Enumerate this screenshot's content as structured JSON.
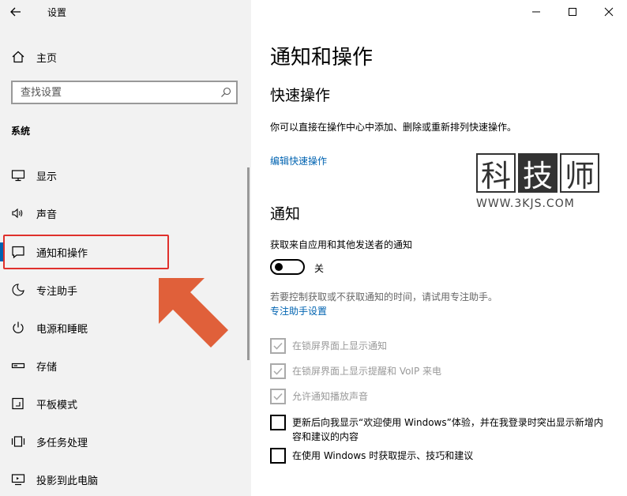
{
  "window": {
    "title": "设置"
  },
  "sidebar": {
    "home_label": "主页",
    "search_placeholder": "查找设置",
    "section": "系统",
    "items": [
      {
        "label": "显示"
      },
      {
        "label": "声音"
      },
      {
        "label": "通知和操作"
      },
      {
        "label": "专注助手"
      },
      {
        "label": "电源和睡眠"
      },
      {
        "label": "存储"
      },
      {
        "label": "平板模式"
      },
      {
        "label": "多任务处理"
      },
      {
        "label": "投影到此电脑"
      }
    ],
    "active_index": 2,
    "highlight_color": "#e0302c",
    "arrow_color": "#e0603a"
  },
  "main": {
    "title": "通知和操作",
    "quick_actions": {
      "heading": "快速操作",
      "description": "你可以直接在操作中心中添加、删除或重新排列快速操作。",
      "link": "编辑快速操作"
    },
    "notifications": {
      "heading": "通知",
      "toggle_label": "获取来自应用和其他发送者的通知",
      "toggle_state": "关",
      "hint": "若要控制获取或不获取通知的时间，请试用专注助手。",
      "hint_link": "专注助手设置",
      "checkboxes": [
        {
          "label": "在锁屏界面上显示通知",
          "checked": true,
          "disabled": true
        },
        {
          "label": "在锁屏界面上显示提醒和 VoIP 来电",
          "checked": true,
          "disabled": true
        },
        {
          "label": "允许通知播放声音",
          "checked": true,
          "disabled": true
        },
        {
          "label": "更新后向我显示“欢迎使用 Windows”体验，并在我登录时突出显示新增内容和建议的内容",
          "checked": false,
          "disabled": false
        },
        {
          "label": "在使用 Windows 时获取提示、技巧和建议",
          "checked": false,
          "disabled": false
        }
      ]
    }
  },
  "watermark": {
    "chars": [
      "科",
      "技",
      "师"
    ],
    "url": "WWW.3KJS.COM"
  },
  "colors": {
    "accent": "#0063b1",
    "sidebar_bg": "#f2f2f2"
  }
}
